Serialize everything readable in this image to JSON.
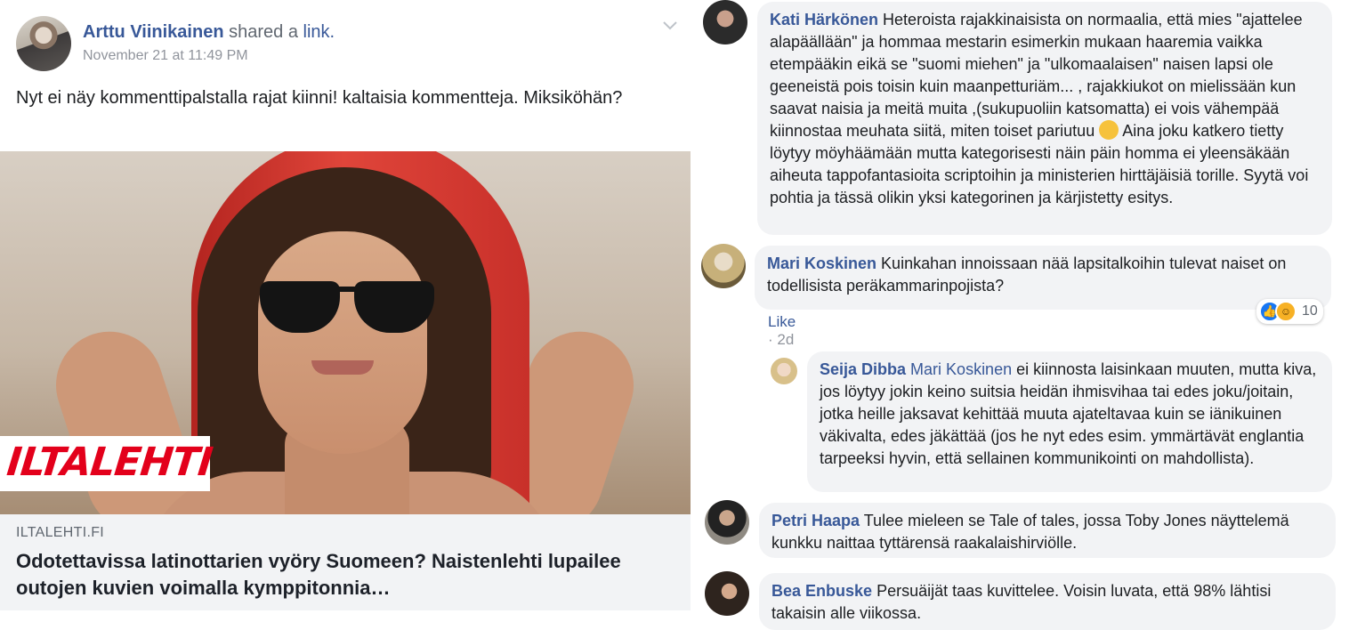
{
  "post": {
    "author": "Arttu Viinikainen",
    "shared_text": "shared a",
    "shared_link": "link.",
    "timestamp": "November 21 at 11:49 PM",
    "text": "Nyt ei näy kommenttipalstalla rajat kiinni! kaltaisia kommentteja. Miksiköhän?",
    "menu_icon": "chevron-down-icon"
  },
  "link_preview": {
    "logo": "ILTALEHTI",
    "domain": "ILTALEHTI.FI",
    "title": "Odotettavissa latinottarien vyöry Suomeen? Naistenlehti lupailee outojen kuvien voimalla kymppitonnia…"
  },
  "comments": [
    {
      "name": "Kati Härkönen",
      "text_a": "Heteroista rajakkinaisista on normaalia, että mies \"ajattelee alapäällään\" ja hommaa mestarin esimerkin mukaan haaremia vaikka etempääkin eikä se \"suomi miehen\" ja \"ulkomaalaisen\" naisen lapsi ole geeneistä pois toisin kuin maanpetturiäm... , rajakkiukot on mielissään kun saavat naisia ja meitä muita ,(sukupuoliin katsomatta) ei vois vähempää kiinnostaa meuhata siitä, miten toiset pariutuu",
      "emoji": "thinking-face-emoji",
      "text_b": "Aina joku katkero tietty löytyy möyhäämään mutta kategorisesti näin päin homma ei yleensäkään aiheuta tappofantasioita scriptoihin ja ministerien hirttäjäisiä torille. Syytä voi pohtia ja tässä olikin yksi kategorinen ja kärjistetty esitys."
    },
    {
      "name": "Mari Koskinen",
      "text": "Kuinkahan innoissaan nää lapsitalkoihin tulevat naiset on todellisista peräkammarinpojista?",
      "like": "Like",
      "time": "2d",
      "reaction_count": "10",
      "reactions": [
        "like-reaction-icon",
        "haha-reaction-icon"
      ]
    },
    {
      "name": "Seija Dibba",
      "tag": "Mari Koskinen",
      "text": "ei kiinnosta laisinkaan muuten, mutta kiva, jos löytyy jokin keino suitsia heidän ihmisvihaa tai edes joku/joitain, jotka heille jaksavat kehittää muuta ajateltavaa kuin se iänikuinen väkivalta, edes jäkättää (jos he nyt edes esim. ymmärtävät englantia tarpeeksi hyvin, että sellainen kommunikointi on mahdollista)."
    },
    {
      "name": "Petri Haapa",
      "text": "Tulee mieleen se Tale of tales, jossa Toby Jones näyttelemä kunkku naittaa tyttärensä raakalaishirviölle."
    },
    {
      "name": "Bea Enbuske",
      "text": "Persuäijät taas kuvittelee. Voisin luvata, että 98% lähtisi takaisin alle viikossa."
    }
  ],
  "colors": {
    "link_blue": "#385898",
    "bubble_bg": "#f2f3f5",
    "caption_bg": "#f2f3f5",
    "logo_red": "#e3001b"
  }
}
